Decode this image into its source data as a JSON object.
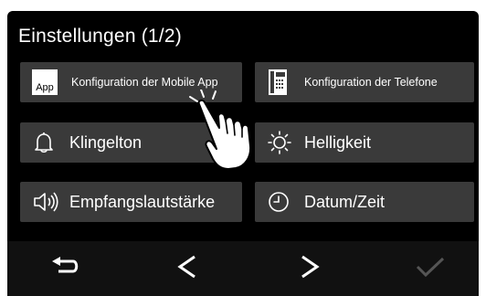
{
  "header": {
    "title": "Einstellungen (1/2)"
  },
  "buttons": {
    "mobile_app": {
      "label": "Konfiguration der Mobile App",
      "icon": "app-icon",
      "icon_text": "App"
    },
    "telefone": {
      "label": "Konfiguration der Telefone",
      "icon": "phone-icon"
    },
    "klingelton": {
      "label": "Klingelton",
      "icon": "bell-icon"
    },
    "helligkeit": {
      "label": "Helligkeit",
      "icon": "sun-icon"
    },
    "lautstaerke": {
      "label": "Empfangslautstärke",
      "icon": "speaker-icon"
    },
    "datum": {
      "label": "Datum/Zeit",
      "icon": "clock-icon"
    }
  },
  "footer": {
    "back": {
      "icon": "return-arrow-icon"
    },
    "prev": {
      "icon": "chevron-left-icon"
    },
    "next": {
      "icon": "chevron-right-icon"
    },
    "confirm": {
      "icon": "checkmark-icon",
      "enabled": false
    }
  },
  "colors": {
    "background": "#000000",
    "button": "#3a3a3a",
    "text": "#ffffff",
    "disabled": "#555555"
  }
}
